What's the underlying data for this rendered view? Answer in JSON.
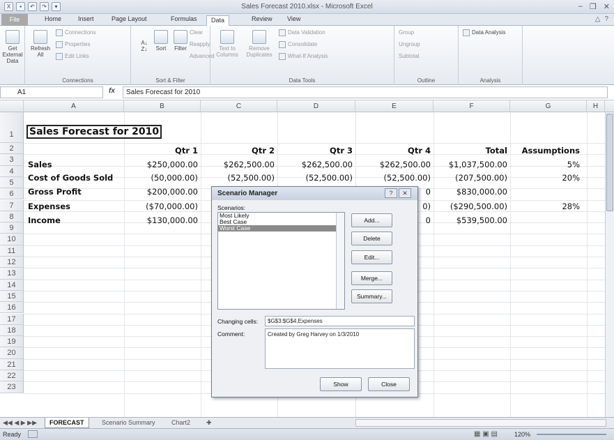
{
  "window": {
    "title": "Sales Forecast 2010.xlsx - Microsoft Excel"
  },
  "ribbon_tabs": [
    "File",
    "Home",
    "Insert",
    "Page Layout",
    "Formulas",
    "Data",
    "Review",
    "View"
  ],
  "ribbon": {
    "get_external": "Get External\nData",
    "refresh": "Refresh\nAll",
    "connections": "Connections",
    "properties": "Properties",
    "edit_links": "Edit Links",
    "connections_group": "Connections",
    "sort": "Sort",
    "filter": "Filter",
    "clear": "Clear",
    "reapply": "Reapply",
    "advanced": "Advanced",
    "sort_group": "Sort & Filter",
    "text_to_columns": "Text to\nColumns",
    "remove_duplicates": "Remove\nDuplicates",
    "data_validation": "Data Validation",
    "consolidate": "Consolidate",
    "what_if": "What-If Analysis",
    "data_tools_group": "Data Tools",
    "group": "Group",
    "ungroup": "Ungroup",
    "subtotal": "Subtotal",
    "outline_group": "Outline",
    "data_analysis": "Data Analysis",
    "analysis_group": "Analysis"
  },
  "formula_bar": {
    "name_box": "A1",
    "fx": "fx",
    "content": "Sales Forecast for 2010"
  },
  "columns": [
    "A",
    "B",
    "C",
    "D",
    "E",
    "F",
    "G",
    "H"
  ],
  "rows": [
    "1",
    "2",
    "3",
    "4",
    "5",
    "6",
    "7",
    "8",
    "9",
    "10",
    "11",
    "12",
    "13",
    "14",
    "15",
    "16",
    "17",
    "18",
    "19",
    "20",
    "21",
    "22",
    "23"
  ],
  "sheet": {
    "title": "Sales Forecast for 2010",
    "headers": [
      "Qtr 1",
      "Qtr 2",
      "Qtr 3",
      "Qtr 4",
      "Total",
      "Assumptions"
    ],
    "labels": [
      "Sales",
      "Cost of Goods Sold",
      "Gross Profit",
      "Expenses",
      "Income"
    ],
    "sales": [
      "$250,000.00",
      "$262,500.00",
      "$262,500.00",
      "$262,500.00",
      "$1,037,500.00",
      "5%"
    ],
    "cogs": [
      "(50,000.00)",
      "(52,500.00)",
      "(52,500.00)",
      "(52,500.00)",
      "(207,500.00)",
      "20%"
    ],
    "gross": [
      "$200,000.00",
      "0",
      "$830,000.00"
    ],
    "expenses": [
      "($70,000.00)",
      "0)",
      "($290,500.00)",
      "28%"
    ],
    "income": [
      "$130,000.00",
      "0",
      "$539,500.00"
    ]
  },
  "dialog": {
    "title": "Scenario Manager",
    "scenarios_label": "Scenarios:",
    "scenarios": [
      "Most Likely",
      "Best Case",
      "Worst Case"
    ],
    "selected": "Worst Case",
    "add": "Add...",
    "delete": "Delete",
    "edit": "Edit...",
    "merge": "Merge...",
    "summary": "Summary...",
    "changing_label": "Changing cells:",
    "changing_value": "$G$3:$G$4,Expenses",
    "comment_label": "Comment:",
    "comment_value": "Created by Greg Harvey on 1/3/2010",
    "show": "Show",
    "close": "Close",
    "help": "?"
  },
  "sheet_tabs": [
    "FORECAST",
    "Scenario Summary",
    "Chart2"
  ],
  "status": {
    "ready": "Ready",
    "zoom": "120%"
  }
}
